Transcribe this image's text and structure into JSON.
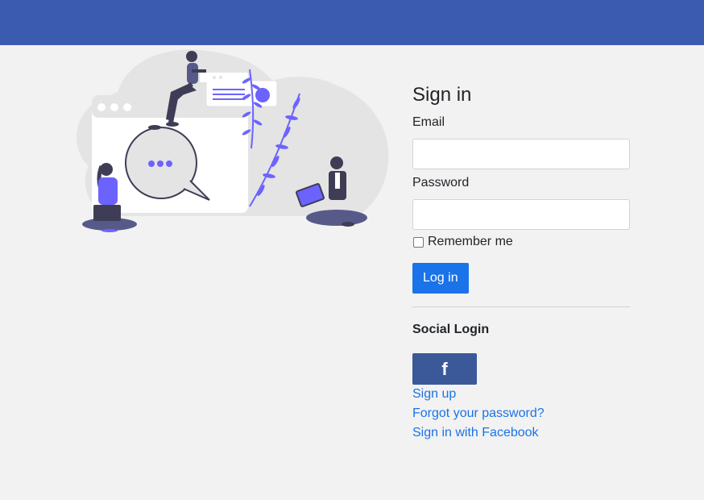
{
  "colors": {
    "topbar": "#3b5bb0",
    "accent": "#1a73e8",
    "facebook": "#3b5998",
    "illustration_purple": "#6c63ff"
  },
  "illustration": {
    "name": "people-chatting-illustration"
  },
  "signin": {
    "title": "Sign in",
    "email_label": "Email",
    "email_value": "",
    "password_label": "Password",
    "password_value": "",
    "remember_label": "Remember me",
    "login_button": "Log in"
  },
  "social": {
    "title": "Social Login",
    "facebook_icon": "facebook-icon",
    "facebook_glyph": "f"
  },
  "links": {
    "signup": "Sign up",
    "forgot": "Forgot your password?",
    "facebook_signin": "Sign in with Facebook"
  }
}
